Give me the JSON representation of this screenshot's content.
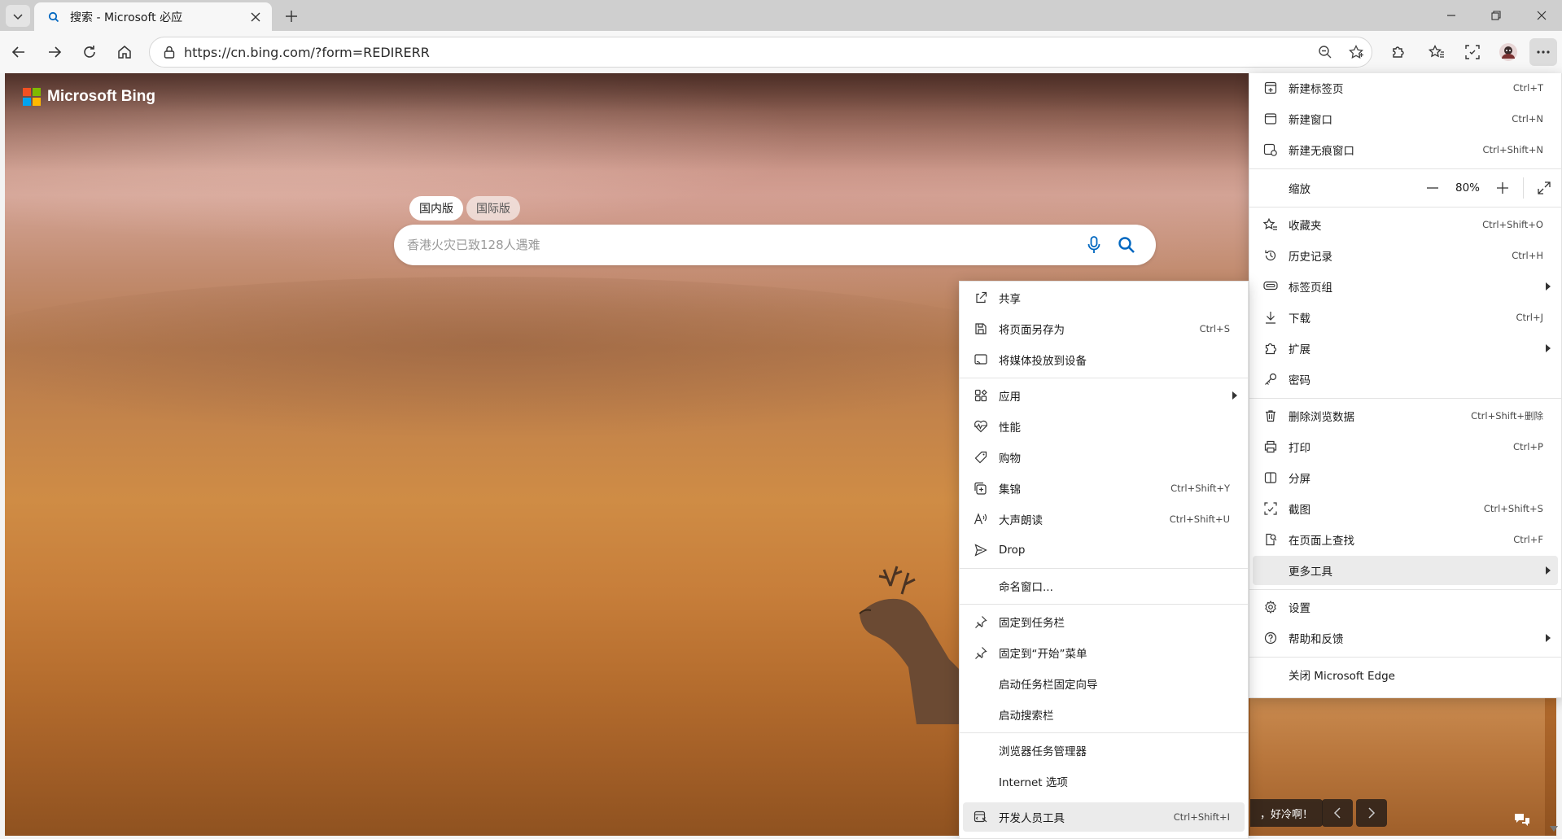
{
  "tab": {
    "title": "搜索 - Microsoft 必应"
  },
  "address": {
    "url": "https://cn.bing.com/?form=REDIRERR"
  },
  "page": {
    "logo_text": "Microsoft Bing",
    "region_tabs": [
      "国内版",
      "国际版"
    ],
    "search_placeholder": "香港火灾已致128人遇难",
    "preview_caption": "，好冷啊！"
  },
  "main_menu": {
    "new_tab": {
      "label": "新建标签页",
      "shortcut": "Ctrl+T"
    },
    "new_window": {
      "label": "新建窗口",
      "shortcut": "Ctrl+N"
    },
    "new_inprivate": {
      "label": "新建无痕窗口",
      "shortcut": "Ctrl+Shift+N"
    },
    "zoom": {
      "label": "缩放",
      "value": "80%"
    },
    "favorites": {
      "label": "收藏夹",
      "shortcut": "Ctrl+Shift+O"
    },
    "history": {
      "label": "历史记录",
      "shortcut": "Ctrl+H"
    },
    "tab_groups": {
      "label": "标签页组"
    },
    "downloads": {
      "label": "下载",
      "shortcut": "Ctrl+J"
    },
    "extensions": {
      "label": "扩展"
    },
    "passwords": {
      "label": "密码"
    },
    "clear_data": {
      "label": "删除浏览数据",
      "shortcut": "Ctrl+Shift+删除"
    },
    "print": {
      "label": "打印",
      "shortcut": "Ctrl+P"
    },
    "split_screen": {
      "label": "分屏"
    },
    "screenshot": {
      "label": "截图",
      "shortcut": "Ctrl+Shift+S"
    },
    "find": {
      "label": "在页面上查找",
      "shortcut": "Ctrl+F"
    },
    "more_tools": {
      "label": "更多工具"
    },
    "settings": {
      "label": "设置"
    },
    "help": {
      "label": "帮助和反馈"
    },
    "close_edge": {
      "label": "关闭 Microsoft Edge"
    }
  },
  "sub_menu": {
    "share": {
      "label": "共享"
    },
    "save_as": {
      "label": "将页面另存为",
      "shortcut": "Ctrl+S"
    },
    "cast": {
      "label": "将媒体投放到设备"
    },
    "apps": {
      "label": "应用"
    },
    "performance": {
      "label": "性能"
    },
    "shopping": {
      "label": "购物"
    },
    "collections": {
      "label": "集锦",
      "shortcut": "Ctrl+Shift+Y"
    },
    "read_aloud": {
      "label": "大声朗读",
      "shortcut": "Ctrl+Shift+U"
    },
    "drop": {
      "label": "Drop"
    },
    "name_window": {
      "label": "命名窗口..."
    },
    "pin_taskbar": {
      "label": "固定到任务栏"
    },
    "pin_start": {
      "label": "固定到“开始”菜单"
    },
    "taskbar_wizard": {
      "label": "启动任务栏固定向导"
    },
    "search_bar": {
      "label": "启动搜索栏"
    },
    "task_manager": {
      "label": "浏览器任务管理器"
    },
    "internet_options": {
      "label": "Internet 选项"
    },
    "dev_tools": {
      "label": "开发人员工具",
      "shortcut": "Ctrl+Shift+I"
    }
  },
  "colors": {
    "accent": "#0067c0",
    "ms_red": "#f25022",
    "ms_green": "#7fba00",
    "ms_blue": "#00a4ef",
    "ms_yellow": "#ffb900"
  }
}
